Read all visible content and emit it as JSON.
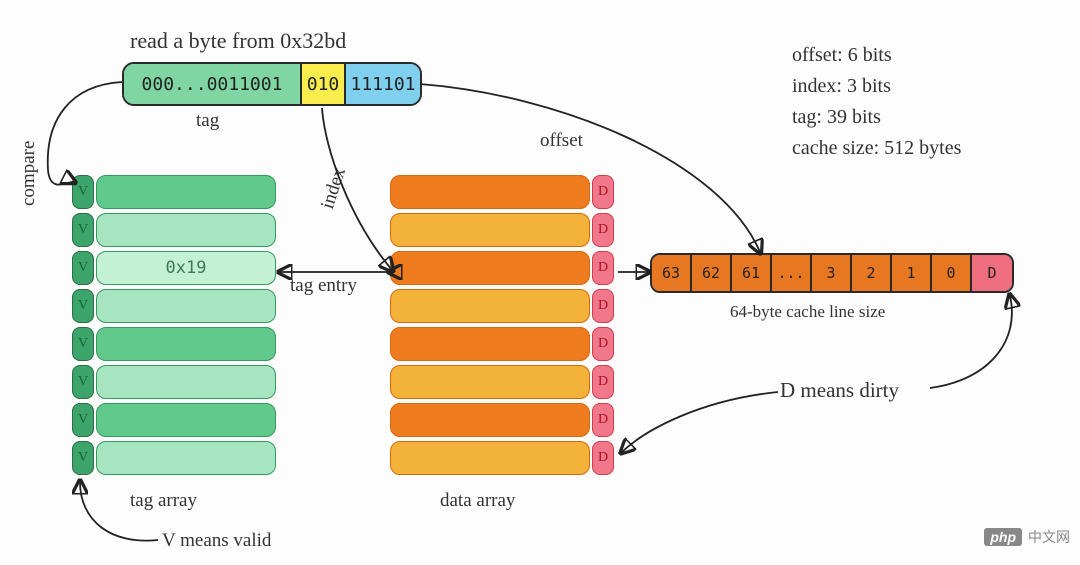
{
  "title": "read a byte from 0x32bd",
  "addr": {
    "tag": "000...0011001",
    "index": "010",
    "offset": "111101"
  },
  "labels": {
    "tag": "tag",
    "offset": "offset",
    "index": "index",
    "compare": "compare",
    "tag_entry": "tag entry",
    "tag_array": "tag array",
    "data_array": "data array",
    "v_means": "V means valid",
    "d_means": "D means dirty",
    "cacheline": "64-byte cache line size"
  },
  "info": {
    "offset": "offset: 6 bits",
    "index": "index: 3 bits",
    "tag": "tag: 39 bits",
    "size": "cache size: 512 bytes"
  },
  "tag_array": {
    "rows": 8,
    "valid_label": "V",
    "highlight_row": 2,
    "highlight_tag_hex": "0x19"
  },
  "data_array": {
    "rows": 8,
    "dirty_label": "D"
  },
  "cache_line": {
    "bytes": [
      "63",
      "62",
      "61",
      "...",
      "3",
      "2",
      "1",
      "0"
    ],
    "dirty": "D"
  },
  "watermark": {
    "logo": "php",
    "text": "中文网"
  }
}
